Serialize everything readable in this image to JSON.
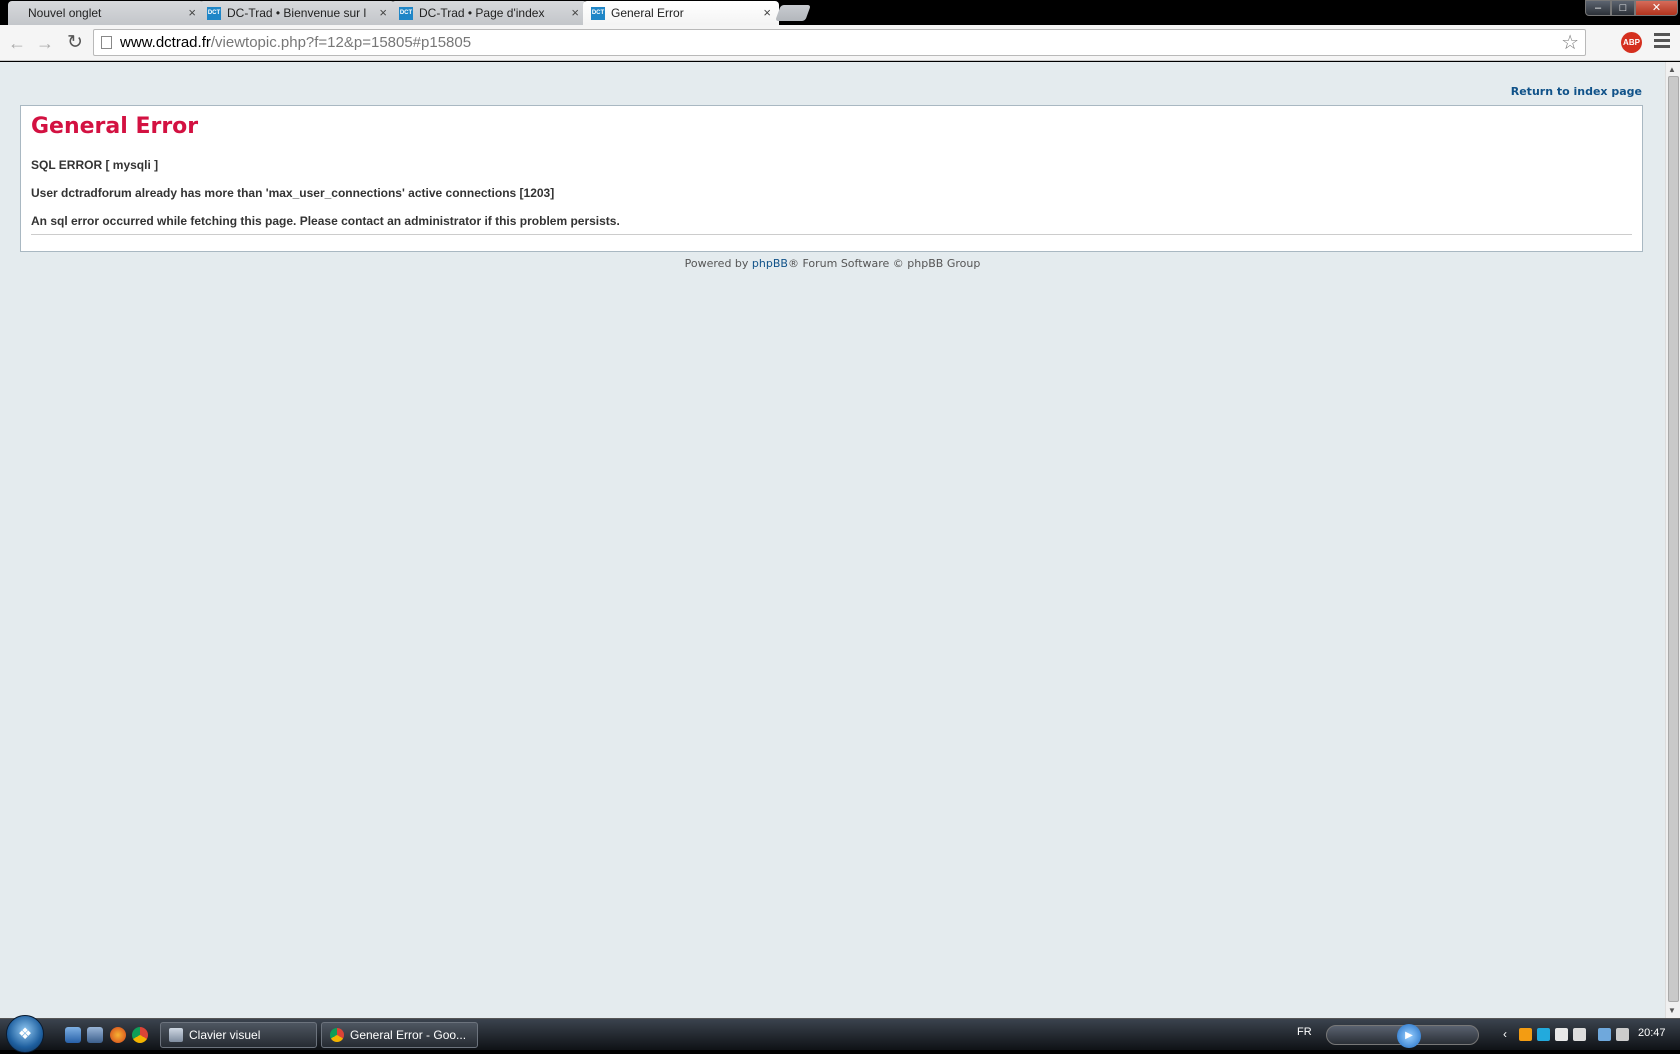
{
  "browser": {
    "tabs": [
      {
        "title": "Nouvel onglet",
        "has_favicon": false,
        "active": false
      },
      {
        "title": "DC-Trad • Bienvenue sur l",
        "has_favicon": true,
        "active": false
      },
      {
        "title": "DC-Trad • Page d'index",
        "has_favicon": true,
        "active": false
      },
      {
        "title": "General Error",
        "has_favicon": true,
        "active": true
      }
    ],
    "favicon_text": "DCT",
    "close_glyph": "×",
    "url_host": "www.dctrad.fr",
    "url_path": "/viewtopic.php?f=12&p=15805#p15805",
    "extension_label": "ABP"
  },
  "page": {
    "return_link": "Return to index page",
    "title": "General Error",
    "lines": [
      "SQL ERROR [ mysqli ]",
      "User dctradforum already has more than 'max_user_connections' active connections [1203]",
      "An sql error occurred while fetching this page. Please contact an administrator if this problem persists."
    ],
    "footer_prefix": "Powered by ",
    "footer_link": "phpBB",
    "footer_suffix": "® Forum Software © phpBB Group"
  },
  "taskbar": {
    "tasks": [
      "Clavier visuel",
      "General Error - Goo..."
    ],
    "language": "FR",
    "clock": "20:47"
  },
  "colors": {
    "error_title": "#d31141",
    "link": "#105289",
    "page_background": "#e4ebee"
  }
}
